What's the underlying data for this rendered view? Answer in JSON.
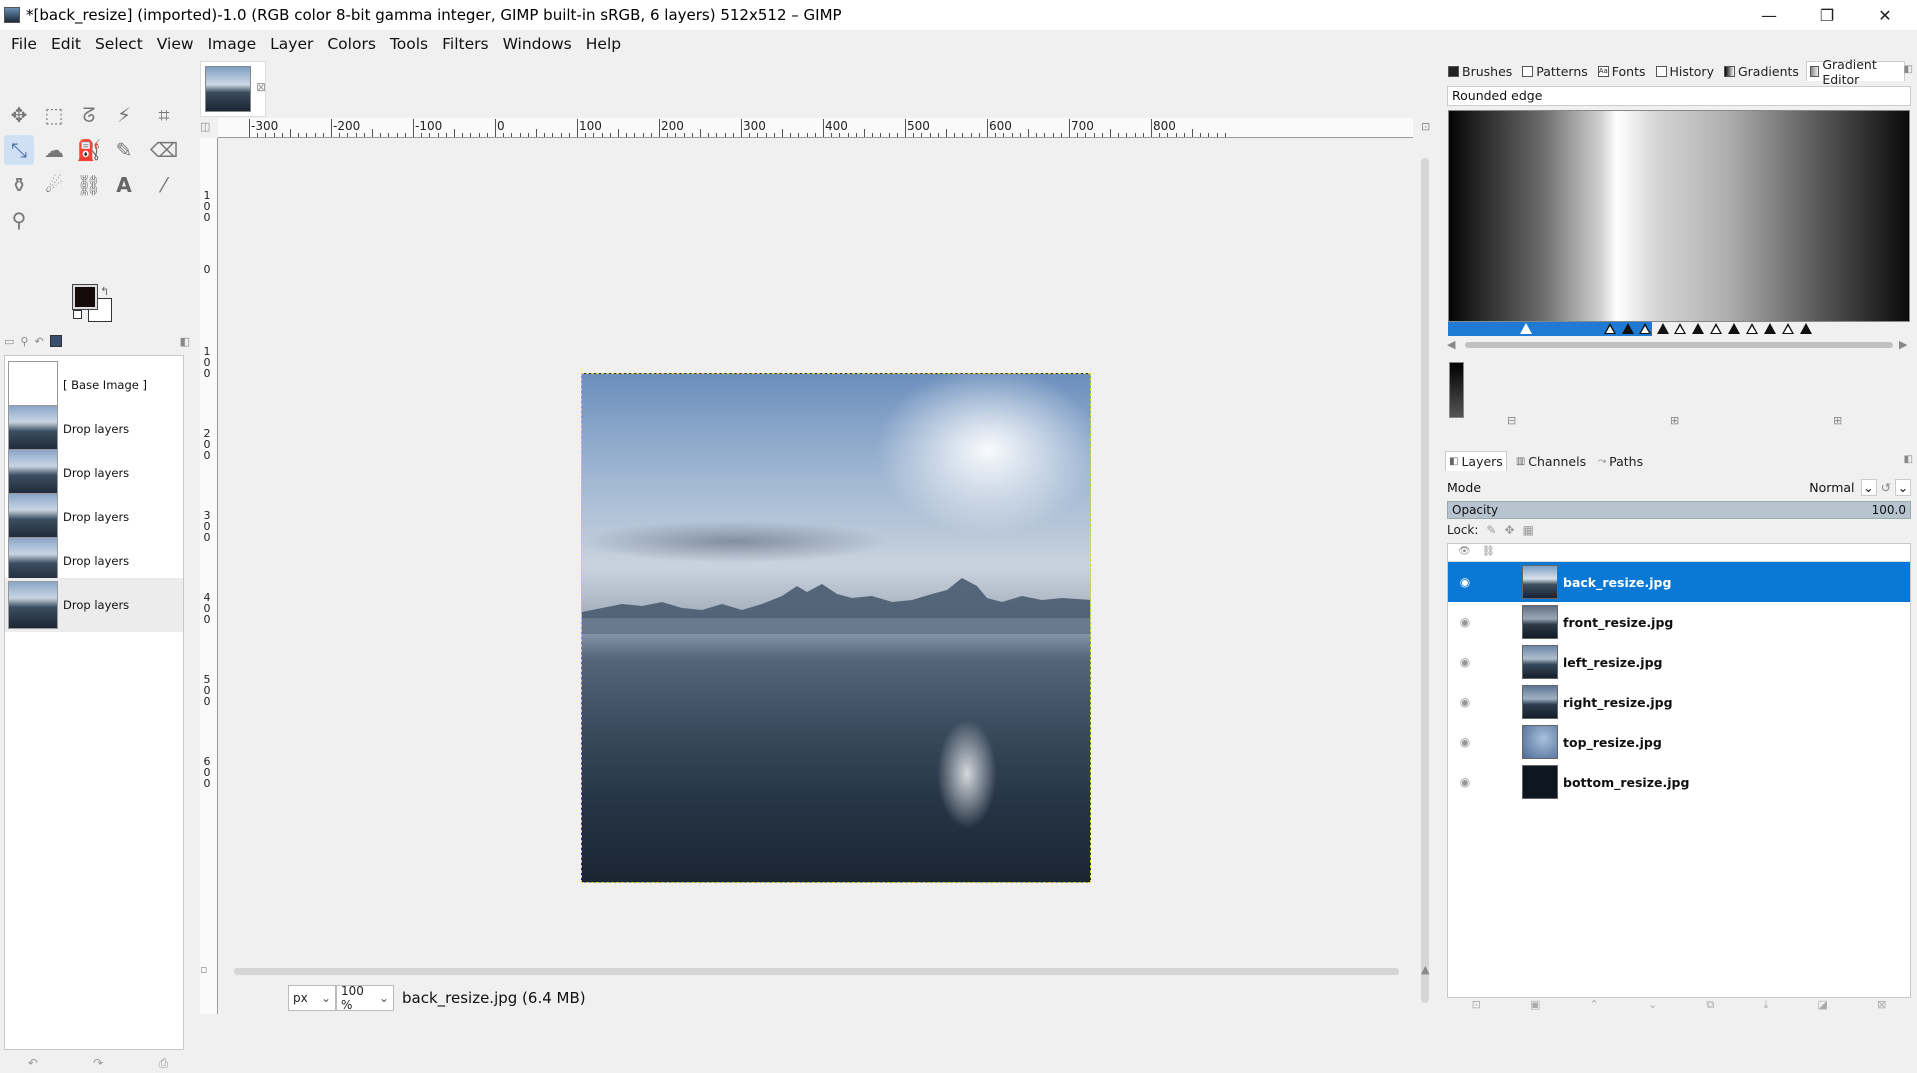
{
  "window": {
    "title": "*[back_resize] (imported)-1.0 (RGB color 8-bit gamma integer, GIMP built-in sRGB, 6 layers) 512x512 – GIMP",
    "minimize": "—",
    "restore": "❐",
    "close": "✕"
  },
  "menu": {
    "items": [
      {
        "label": "File"
      },
      {
        "label": "Edit"
      },
      {
        "label": "Select"
      },
      {
        "label": "View"
      },
      {
        "label": "Image"
      },
      {
        "label": "Layer"
      },
      {
        "label": "Colors"
      },
      {
        "label": "Tools"
      },
      {
        "label": "Filters"
      },
      {
        "label": "Windows"
      },
      {
        "label": "Help"
      }
    ]
  },
  "toolbox": {
    "tools": [
      {
        "name": "move-tool-icon",
        "glyph": "✥"
      },
      {
        "name": "rect-select-tool-icon",
        "glyph": "⬚"
      },
      {
        "name": "free-select-tool-icon",
        "glyph": "ᘔ"
      },
      {
        "name": "fuzzy-select-tool-icon",
        "glyph": "⚡"
      },
      {
        "name": "crop-tool-icon",
        "glyph": "⌗"
      },
      {
        "name": "unified-transform-tool-icon",
        "glyph": "⤡"
      },
      {
        "name": "warp-transform-tool-icon",
        "glyph": "☁"
      },
      {
        "name": "bucket-fill-tool-icon",
        "glyph": "⛽"
      },
      {
        "name": "paintbrush-tool-icon",
        "glyph": "✎"
      },
      {
        "name": "eraser-tool-icon",
        "glyph": "⌫"
      },
      {
        "name": "clone-tool-icon",
        "glyph": "⚱"
      },
      {
        "name": "smudge-tool-icon",
        "glyph": "☄"
      },
      {
        "name": "paths-tool-icon",
        "glyph": "⛓"
      },
      {
        "name": "text-tool-icon",
        "glyph": "A"
      },
      {
        "name": "color-picker-tool-icon",
        "glyph": "⁄"
      },
      {
        "name": "zoom-tool-icon",
        "glyph": "⚲"
      }
    ],
    "images": [
      {
        "label": "[ Base Image ]"
      },
      {
        "label": "Drop layers"
      },
      {
        "label": "Drop layers"
      },
      {
        "label": "Drop layers"
      },
      {
        "label": "Drop layers"
      },
      {
        "label": "Drop layers"
      }
    ]
  },
  "canvas": {
    "hruler_labels": [
      "-300",
      "-200",
      "-100",
      "0",
      "100",
      "200",
      "300",
      "400",
      "500",
      "600",
      "700",
      "800"
    ],
    "vruler_labels": [
      "100",
      "0",
      "100",
      "200",
      "300",
      "400",
      "500",
      "600"
    ],
    "unit": "px",
    "zoom": "100 %",
    "status": "back_resize.jpg (6.4 MB)"
  },
  "gradient_editor": {
    "tabs": [
      {
        "label": "Brushes"
      },
      {
        "label": "Patterns"
      },
      {
        "label": "Fonts"
      },
      {
        "label": "History"
      },
      {
        "label": "Gradients"
      },
      {
        "label": "Gradient Editor"
      }
    ],
    "gradient_name": "Rounded edge"
  },
  "layers_panel": {
    "tabs": [
      {
        "label": "Layers"
      },
      {
        "label": "Channels"
      },
      {
        "label": "Paths"
      }
    ],
    "mode_label": "Mode",
    "mode_value": "Normal",
    "opacity_label": "Opacity",
    "opacity_value": "100.0",
    "lock_label": "Lock:",
    "layers": [
      {
        "name": "back_resize.jpg"
      },
      {
        "name": "front_resize.jpg"
      },
      {
        "name": "left_resize.jpg"
      },
      {
        "name": "right_resize.jpg"
      },
      {
        "name": "top_resize.jpg"
      },
      {
        "name": "bottom_resize.jpg"
      }
    ]
  },
  "colors": {
    "selection": "#0a79d6",
    "foreground": "#150b0b",
    "background": "#ffffff"
  }
}
